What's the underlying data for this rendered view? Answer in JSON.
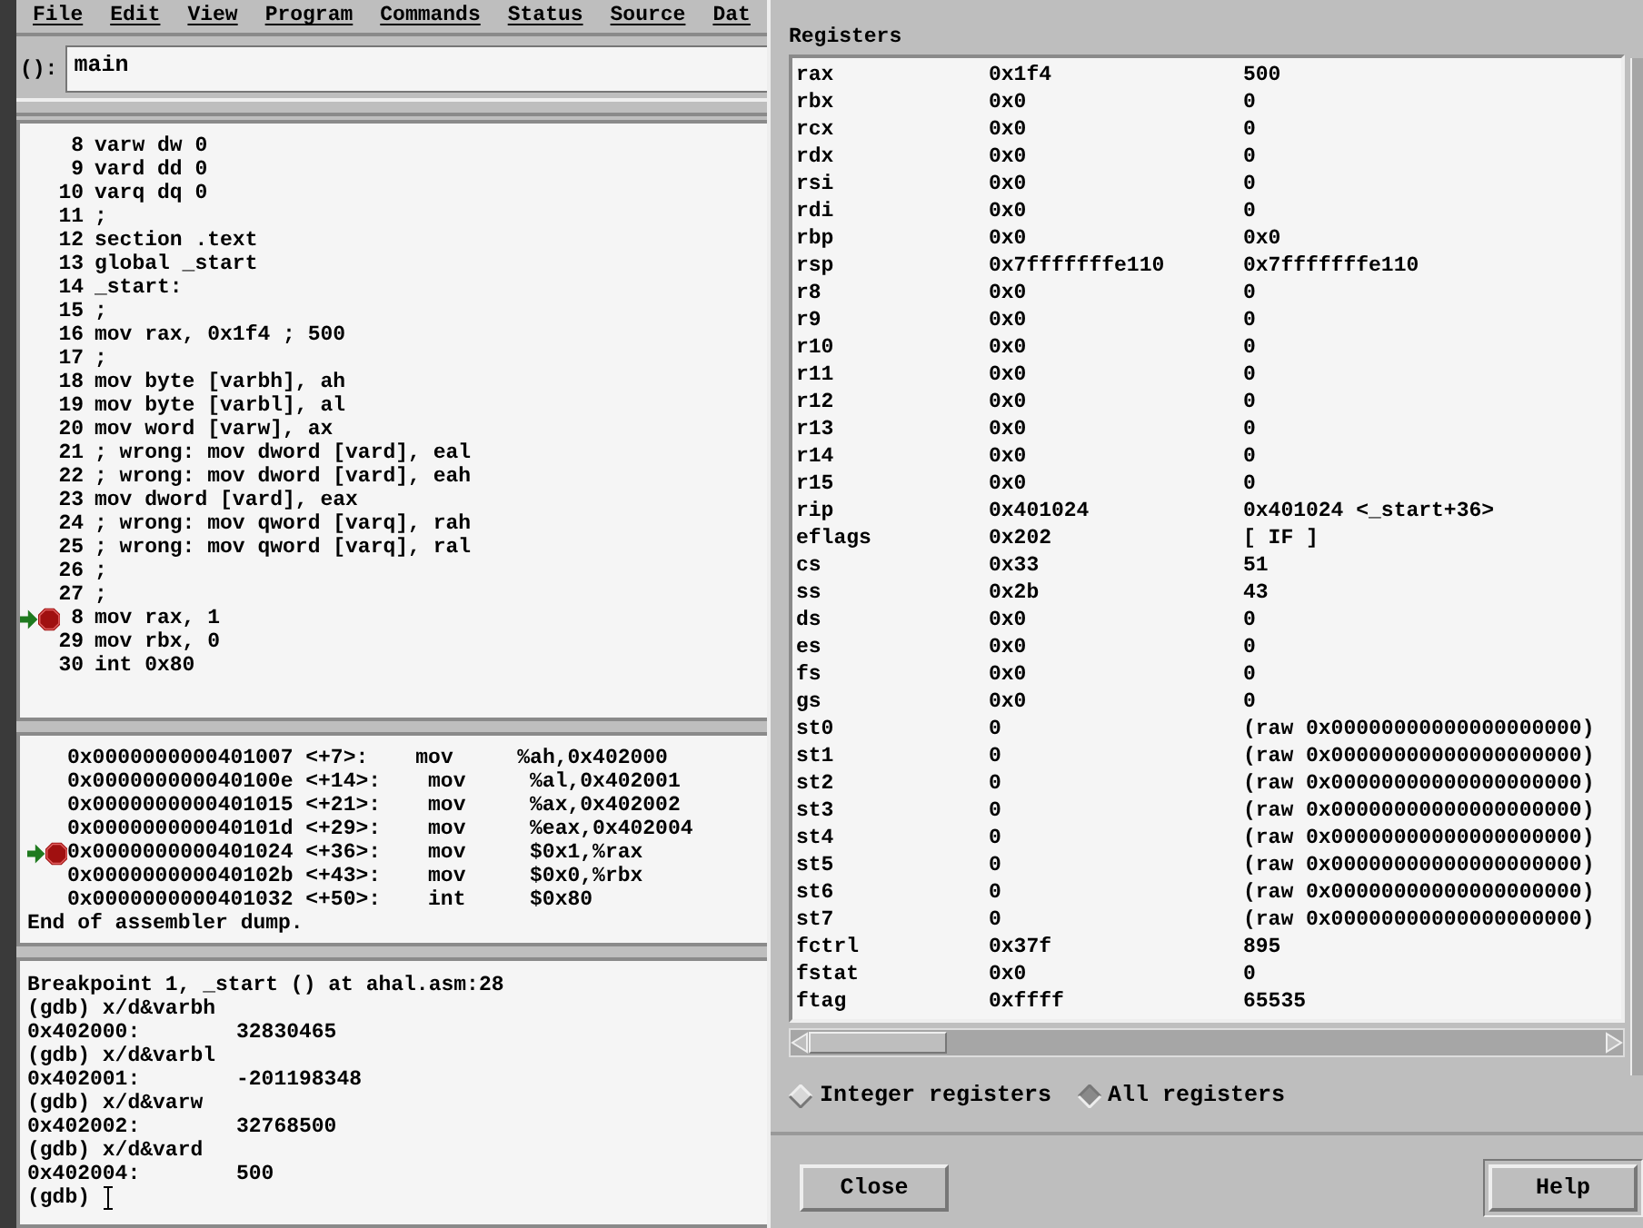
{
  "menu": [
    {
      "label": "File"
    },
    {
      "label": "Edit"
    },
    {
      "label": "View"
    },
    {
      "label": "Program"
    },
    {
      "label": "Commands"
    },
    {
      "label": "Status"
    },
    {
      "label": "Source"
    },
    {
      "label": "Dat"
    }
  ],
  "argument": {
    "label": "():",
    "value": "main"
  },
  "source": {
    "lines": [
      {
        "number": "8",
        "text": "varw dw 0",
        "breakpoint": false,
        "current": false
      },
      {
        "number": "9",
        "text": "vard dd 0",
        "breakpoint": false,
        "current": false
      },
      {
        "number": "10",
        "text": "varq dq 0",
        "breakpoint": false,
        "current": false
      },
      {
        "number": "11",
        "text": ";",
        "breakpoint": false,
        "current": false
      },
      {
        "number": "12",
        "text": "section .text",
        "breakpoint": false,
        "current": false
      },
      {
        "number": "13",
        "text": "global _start",
        "breakpoint": false,
        "current": false
      },
      {
        "number": "14",
        "text": "_start:",
        "breakpoint": false,
        "current": false
      },
      {
        "number": "15",
        "text": ";",
        "breakpoint": false,
        "current": false
      },
      {
        "number": "16",
        "text": "mov rax, 0x1f4 ; 500",
        "breakpoint": false,
        "current": false
      },
      {
        "number": "17",
        "text": ";",
        "breakpoint": false,
        "current": false
      },
      {
        "number": "18",
        "text": "mov byte [varbh], ah",
        "breakpoint": false,
        "current": false
      },
      {
        "number": "19",
        "text": "mov byte [varbl], al",
        "breakpoint": false,
        "current": false
      },
      {
        "number": "20",
        "text": "mov word [varw], ax",
        "breakpoint": false,
        "current": false
      },
      {
        "number": "21",
        "text": "; wrong: mov dword [vard], eal",
        "breakpoint": false,
        "current": false
      },
      {
        "number": "22",
        "text": "; wrong: mov dword [vard], eah",
        "breakpoint": false,
        "current": false
      },
      {
        "number": "23",
        "text": "mov dword [vard], eax",
        "breakpoint": false,
        "current": false
      },
      {
        "number": "24",
        "text": "; wrong: mov qword [varq], rah",
        "breakpoint": false,
        "current": false
      },
      {
        "number": "25",
        "text": "; wrong: mov qword [varq], ral",
        "breakpoint": false,
        "current": false
      },
      {
        "number": "26",
        "text": ";",
        "breakpoint": false,
        "current": false
      },
      {
        "number": "27",
        "text": ";",
        "breakpoint": false,
        "current": false
      },
      {
        "number": "8",
        "text": "mov rax, 1",
        "breakpoint": true,
        "current": true
      },
      {
        "number": "29",
        "text": "mov rbx, 0",
        "breakpoint": false,
        "current": false
      },
      {
        "number": "30",
        "text": "int 0x80",
        "breakpoint": false,
        "current": false
      }
    ]
  },
  "assembler": {
    "lines": [
      {
        "address": "0x0000000000401007",
        "offset": "<+7>:",
        "op": "mov",
        "args": "%ah,0x402000",
        "breakpoint": false,
        "current": false
      },
      {
        "address": "0x000000000040100e",
        "offset": "<+14>:",
        "op": "mov",
        "args": "%al,0x402001",
        "breakpoint": false,
        "current": false
      },
      {
        "address": "0x0000000000401015",
        "offset": "<+21>:",
        "op": "mov",
        "args": "%ax,0x402002",
        "breakpoint": false,
        "current": false
      },
      {
        "address": "0x000000000040101d",
        "offset": "<+29>:",
        "op": "mov",
        "args": "%eax,0x402004",
        "breakpoint": false,
        "current": false
      },
      {
        "address": "0x0000000000401024",
        "offset": "<+36>:",
        "op": "mov",
        "args": "$0x1,%rax",
        "breakpoint": true,
        "current": true
      },
      {
        "address": "0x000000000040102b",
        "offset": "<+43>:",
        "op": "mov",
        "args": "$0x0,%rbx",
        "breakpoint": false,
        "current": false
      },
      {
        "address": "0x0000000000401032",
        "offset": "<+50>:",
        "op": "int",
        "args": "$0x80",
        "breakpoint": false,
        "current": false
      }
    ],
    "footer": "End of assembler dump."
  },
  "console": {
    "lines": [
      {
        "kind": "text",
        "text": "Breakpoint 1, _start () at ahal.asm:28"
      },
      {
        "kind": "text",
        "text": "(gdb) x/d&varbh"
      },
      {
        "kind": "value",
        "address": "0x402000:",
        "value": "32830465"
      },
      {
        "kind": "text",
        "text": "(gdb) x/d&varbl"
      },
      {
        "kind": "value",
        "address": "0x402001:",
        "value": "-201198348"
      },
      {
        "kind": "text",
        "text": "(gdb) x/d&varw"
      },
      {
        "kind": "value",
        "address": "0x402002:",
        "value": "32768500"
      },
      {
        "kind": "text",
        "text": "(gdb) x/d&vard"
      },
      {
        "kind": "value",
        "address": "0x402004:",
        "value": "500"
      },
      {
        "kind": "prompt",
        "text": "(gdb)"
      }
    ]
  },
  "registers_dialog": {
    "title": "Registers",
    "rows": [
      {
        "name": "rax",
        "hex": "0x1f4",
        "natural": "500"
      },
      {
        "name": "rbx",
        "hex": "0x0",
        "natural": "0"
      },
      {
        "name": "rcx",
        "hex": "0x0",
        "natural": "0"
      },
      {
        "name": "rdx",
        "hex": "0x0",
        "natural": "0"
      },
      {
        "name": "rsi",
        "hex": "0x0",
        "natural": "0"
      },
      {
        "name": "rdi",
        "hex": "0x0",
        "natural": "0"
      },
      {
        "name": "rbp",
        "hex": "0x0",
        "natural": "0x0"
      },
      {
        "name": "rsp",
        "hex": "0x7fffffffe110",
        "natural": "0x7fffffffe110"
      },
      {
        "name": "r8",
        "hex": "0x0",
        "natural": "0"
      },
      {
        "name": "r9",
        "hex": "0x0",
        "natural": "0"
      },
      {
        "name": "r10",
        "hex": "0x0",
        "natural": "0"
      },
      {
        "name": "r11",
        "hex": "0x0",
        "natural": "0"
      },
      {
        "name": "r12",
        "hex": "0x0",
        "natural": "0"
      },
      {
        "name": "r13",
        "hex": "0x0",
        "natural": "0"
      },
      {
        "name": "r14",
        "hex": "0x0",
        "natural": "0"
      },
      {
        "name": "r15",
        "hex": "0x0",
        "natural": "0"
      },
      {
        "name": "rip",
        "hex": "0x401024",
        "natural": "0x401024 <_start+36>"
      },
      {
        "name": "eflags",
        "hex": "0x202",
        "natural": "[ IF ]"
      },
      {
        "name": "cs",
        "hex": "0x33",
        "natural": "51"
      },
      {
        "name": "ss",
        "hex": "0x2b",
        "natural": "43"
      },
      {
        "name": "ds",
        "hex": "0x0",
        "natural": "0"
      },
      {
        "name": "es",
        "hex": "0x0",
        "natural": "0"
      },
      {
        "name": "fs",
        "hex": "0x0",
        "natural": "0"
      },
      {
        "name": "gs",
        "hex": "0x0",
        "natural": "0"
      },
      {
        "name": "st0",
        "hex": "0",
        "natural": "(raw 0x00000000000000000000)"
      },
      {
        "name": "st1",
        "hex": "0",
        "natural": "(raw 0x00000000000000000000)"
      },
      {
        "name": "st2",
        "hex": "0",
        "natural": "(raw 0x00000000000000000000)"
      },
      {
        "name": "st3",
        "hex": "0",
        "natural": "(raw 0x00000000000000000000)"
      },
      {
        "name": "st4",
        "hex": "0",
        "natural": "(raw 0x00000000000000000000)"
      },
      {
        "name": "st5",
        "hex": "0",
        "natural": "(raw 0x00000000000000000000)"
      },
      {
        "name": "st6",
        "hex": "0",
        "natural": "(raw 0x00000000000000000000)"
      },
      {
        "name": "st7",
        "hex": "0",
        "natural": "(raw 0x00000000000000000000)"
      },
      {
        "name": "fctrl",
        "hex": "0x37f",
        "natural": "895"
      },
      {
        "name": "fstat",
        "hex": "0x0",
        "natural": "0"
      },
      {
        "name": "ftag",
        "hex": "0xffff",
        "natural": "65535"
      }
    ],
    "options": [
      {
        "label": "Integer registers",
        "selected": false
      },
      {
        "label": "All registers",
        "selected": true
      }
    ],
    "buttons": [
      {
        "label": "Close",
        "default": false
      },
      {
        "label": "Help",
        "default": true
      }
    ]
  }
}
